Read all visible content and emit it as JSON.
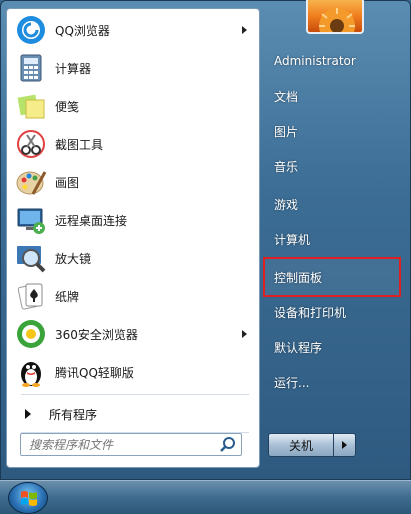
{
  "programs": [
    {
      "label": "QQ浏览器",
      "icon": "qq-browser-icon",
      "has_submenu": true
    },
    {
      "label": "计算器",
      "icon": "calculator-icon",
      "has_submenu": false
    },
    {
      "label": "便笺",
      "icon": "sticky-notes-icon",
      "has_submenu": false
    },
    {
      "label": "截图工具",
      "icon": "snipping-tool-icon",
      "has_submenu": false
    },
    {
      "label": "画图",
      "icon": "paint-icon",
      "has_submenu": false
    },
    {
      "label": "远程桌面连接",
      "icon": "remote-desktop-icon",
      "has_submenu": false
    },
    {
      "label": "放大镜",
      "icon": "magnifier-icon",
      "has_submenu": false
    },
    {
      "label": "纸牌",
      "icon": "solitaire-icon",
      "has_submenu": false
    },
    {
      "label": "360安全浏览器",
      "icon": "360-browser-icon",
      "has_submenu": true
    },
    {
      "label": "腾讯QQ轻聊版",
      "icon": "qq-penguin-icon",
      "has_submenu": false
    }
  ],
  "all_programs_label": "所有程序",
  "search": {
    "placeholder": "搜索程序和文件",
    "icon": "search-icon"
  },
  "right_menu": [
    {
      "label": "Administrator",
      "highlight": false
    },
    {
      "label": "文档",
      "highlight": false
    },
    {
      "label": "图片",
      "highlight": false
    },
    {
      "label": "音乐",
      "highlight": false
    },
    {
      "label": "游戏",
      "highlight": false
    },
    {
      "label": "计算机",
      "highlight": false
    },
    {
      "label": "控制面板",
      "highlight": true
    },
    {
      "label": "设备和打印机",
      "highlight": false
    },
    {
      "label": "默认程序",
      "highlight": false
    },
    {
      "label": "运行...",
      "highlight": false
    }
  ],
  "shutdown": {
    "label": "关机"
  },
  "colors": {
    "highlight_border": "#e02020",
    "panel_blue": "#3c6d95"
  }
}
